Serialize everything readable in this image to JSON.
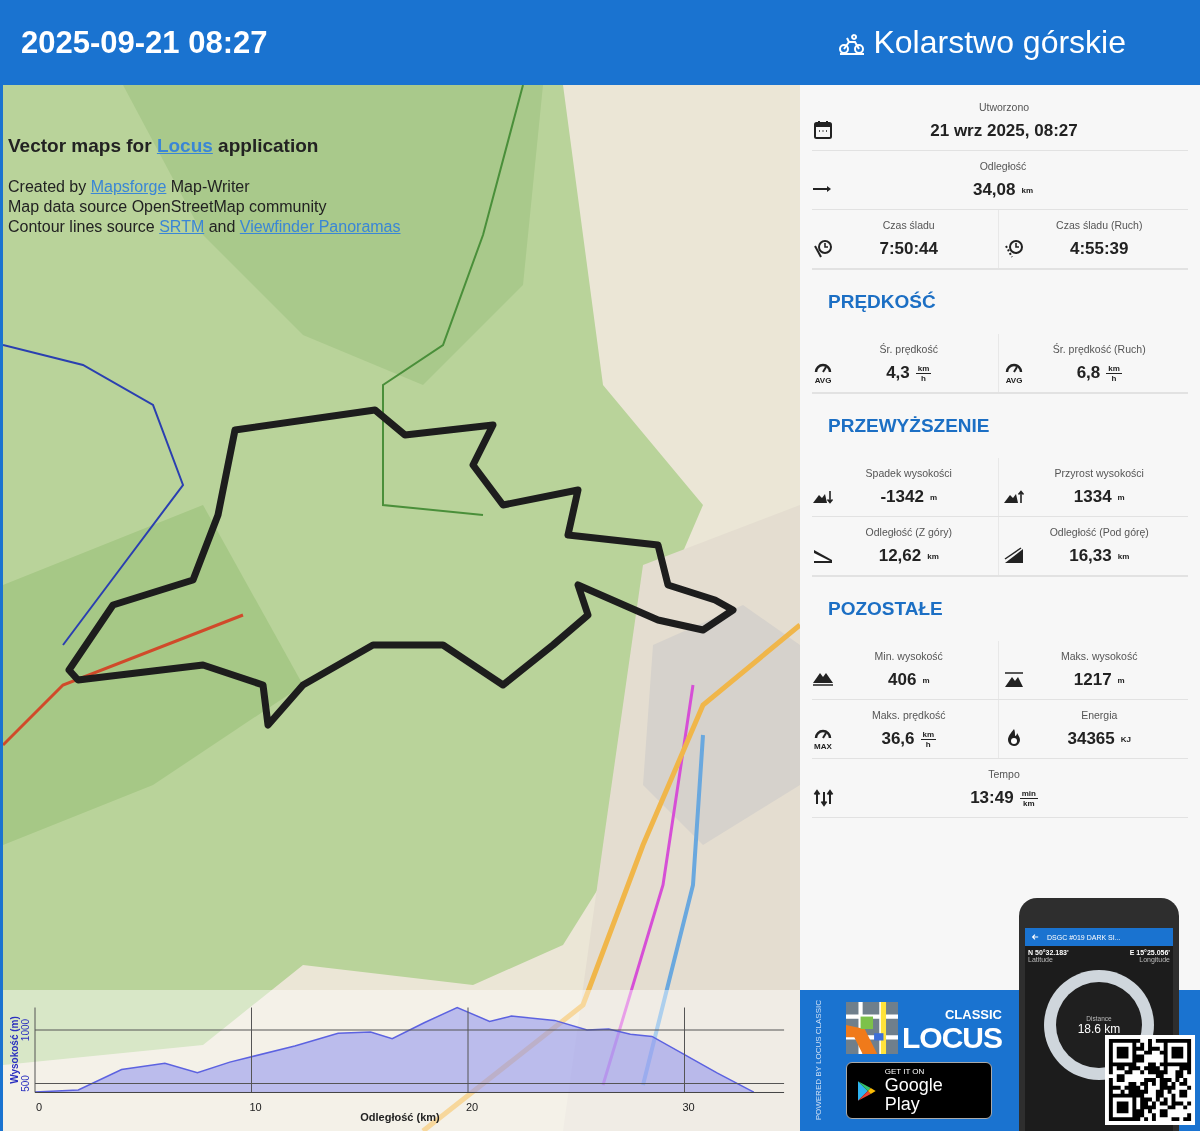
{
  "header": {
    "date": "2025-09-21 08:27",
    "activity": "Kolarstwo górskie"
  },
  "map": {
    "attribution": {
      "title": [
        {
          "text": "Vector maps for ",
          "link": false
        },
        {
          "text": "Locus",
          "link": true
        },
        {
          "text": " application",
          "link": false
        }
      ],
      "lines": [
        [
          {
            "text": "Created by ",
            "link": false
          },
          {
            "text": "Mapsforge",
            "link": true
          },
          {
            "text": " Map-Writer",
            "link": false
          }
        ],
        [
          {
            "text": "Map data source OpenStreetMap community",
            "link": false
          }
        ],
        [
          {
            "text": "Contour lines source ",
            "link": false
          },
          {
            "text": "SRTM",
            "link": true
          },
          {
            "text": " and ",
            "link": false
          },
          {
            "text": "Viewfinder Panoramas",
            "link": true
          }
        ]
      ]
    },
    "elevation": {
      "chart_data": {
        "type": "area",
        "xlabel": "Odległość (km)",
        "ylabel": "Wysokość (m)",
        "x": [
          0,
          2,
          4,
          6,
          7.5,
          9,
          12,
          14,
          15.5,
          16.5,
          18,
          19.5,
          21,
          22,
          24,
          25.5,
          26.5,
          27.5,
          28.5,
          30,
          31.5,
          33,
          33.2
        ],
        "series": [
          {
            "color": "#5c62e0",
            "values": [
              420,
              440,
              630,
              690,
              600,
              700,
              850,
              970,
              980,
              920,
              1070,
              1210,
              1080,
              1130,
              1090,
              1000,
              1010,
              960,
              940,
              770,
              600,
              440,
              420
            ]
          }
        ],
        "grid": true,
        "xlim": [
          0,
          34.6
        ],
        "ylim": [
          416,
          1210
        ],
        "xticks": [
          0,
          10,
          20,
          30
        ],
        "yticks": [
          500,
          1000
        ]
      }
    }
  },
  "stats": {
    "sections": [
      {
        "rows": [
          {
            "cells": [
              {
                "label": "Utworzono",
                "value": "21 wrz 2025, 08:27"
              }
            ]
          },
          {
            "cells": [
              {
                "label": "Odległość",
                "value": "34,08",
                "unit": "km"
              }
            ]
          },
          {
            "cells": [
              {
                "label": "Czas śladu",
                "value": "7:50:44"
              },
              {
                "label": "Czas śladu (Ruch)",
                "value": "4:55:39"
              }
            ]
          }
        ]
      },
      {
        "title": "PRĘDKOŚĆ",
        "rows": [
          {
            "cells": [
              {
                "label": "Śr. prędkość",
                "value": "4,3",
                "unit_top": "km",
                "unit_bottom": "h",
                "icon_label": "AVG"
              },
              {
                "label": "Śr. prędkość (Ruch)",
                "value": "6,8",
                "unit_top": "km",
                "unit_bottom": "h",
                "icon_label": "AVG"
              }
            ]
          }
        ]
      },
      {
        "title": "PRZEWYŻSZENIE",
        "rows": [
          {
            "cells": [
              {
                "label": "Spadek wysokości",
                "value": "-1342",
                "unit": "m"
              },
              {
                "label": "Przyrost wysokości",
                "value": "1334",
                "unit": "m"
              }
            ]
          },
          {
            "cells": [
              {
                "label": "Odległość (Z góry)",
                "value": "12,62",
                "unit": "km"
              },
              {
                "label": "Odległość (Pod górę)",
                "value": "16,33",
                "unit": "km"
              }
            ]
          }
        ]
      },
      {
        "title": "POZOSTAŁE",
        "rows": [
          {
            "cells": [
              {
                "label": "Min. wysokość",
                "value": "406",
                "unit": "m"
              },
              {
                "label": "Maks. wysokość",
                "value": "1217",
                "unit": "m"
              }
            ]
          },
          {
            "cells": [
              {
                "label": "Maks. prędkość",
                "value": "36,6",
                "unit_top": "km",
                "unit_bottom": "h",
                "icon_label": "MAX"
              },
              {
                "label": "Energia",
                "value": "34365",
                "unit": "KJ"
              }
            ]
          },
          {
            "cells": [
              {
                "label": "Tempo",
                "value": "13:49",
                "unit_top": "min",
                "unit_bottom": "km"
              }
            ]
          }
        ]
      }
    ]
  },
  "promo": {
    "powered": "POWERED BY LOCUS CLASSIC",
    "edition": "CLASSIC",
    "brand": "LOCUS",
    "store_small": "GET IT ON",
    "store": "Google Play",
    "phone": {
      "title": "DSGC #019 DARK SI...",
      "lat": "N 50°32.183'",
      "lat_label": "Latitude",
      "lon": "E 15°25.056'",
      "lon_label": "Longitude",
      "distance_label": "Distance",
      "distance": "18.6 km"
    }
  }
}
